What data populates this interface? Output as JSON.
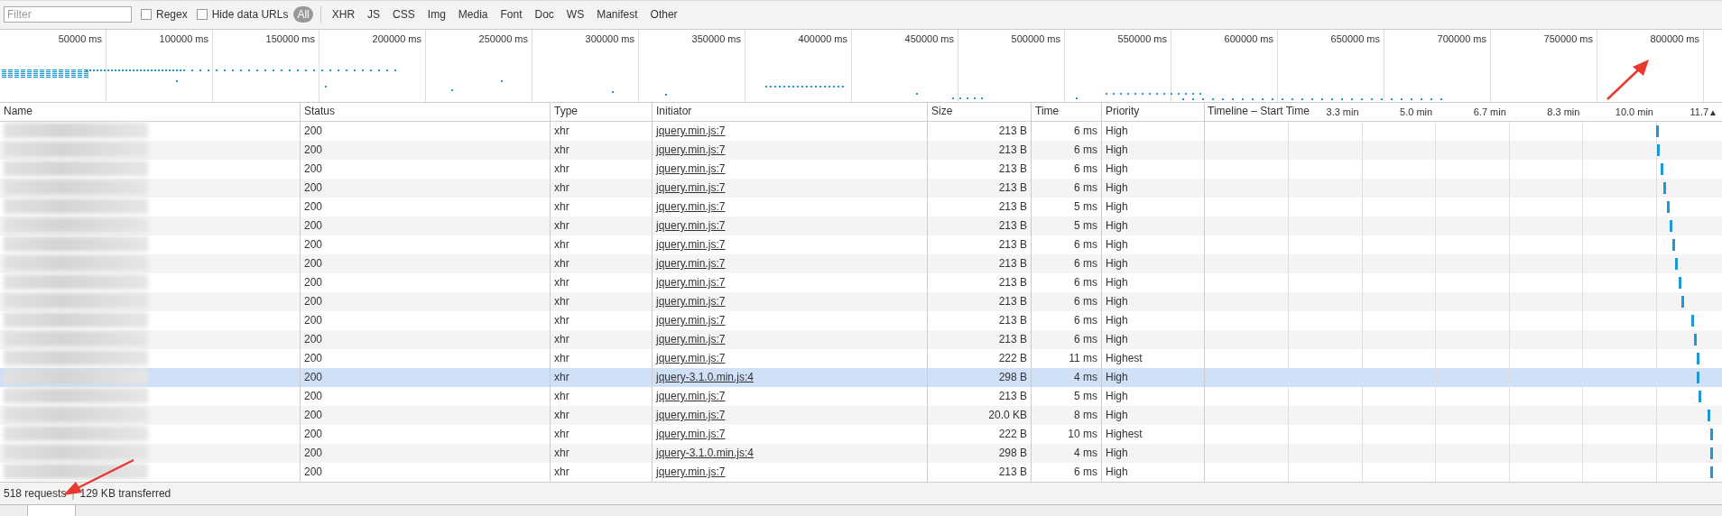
{
  "toolbar": {
    "filter": {
      "placeholder": "Filter"
    },
    "options": [
      {
        "label": "Regex",
        "checked": false
      },
      {
        "label": "Hide data URLs",
        "checked": false
      }
    ],
    "types": [
      {
        "label": "All",
        "selected": true
      },
      {
        "label": "XHR",
        "selected": false
      },
      {
        "label": "JS",
        "selected": false
      },
      {
        "label": "CSS",
        "selected": false
      },
      {
        "label": "Img",
        "selected": false
      },
      {
        "label": "Media",
        "selected": false
      },
      {
        "label": "Font",
        "selected": false
      },
      {
        "label": "Doc",
        "selected": false
      },
      {
        "label": "WS",
        "selected": false
      },
      {
        "label": "Manifest",
        "selected": false
      },
      {
        "label": "Other",
        "selected": false
      }
    ]
  },
  "overview": {
    "ticks": [
      "50000 ms",
      "100000 ms",
      "150000 ms",
      "200000 ms",
      "250000 ms",
      "300000 ms",
      "350000 ms",
      "400000 ms",
      "450000 ms",
      "500000 ms",
      "550000 ms",
      "600000 ms",
      "650000 ms",
      "700000 ms",
      "750000 ms",
      "800000 ms"
    ]
  },
  "table": {
    "columns": [
      "Name",
      "Status",
      "Type",
      "Initiator",
      "Size",
      "Time",
      "Priority"
    ],
    "rows": [
      {
        "status": "200",
        "type": "xhr",
        "initiator": "jquery.min.js:7",
        "size": "213 B",
        "time": "6 ms",
        "priority": "High",
        "selected": false
      },
      {
        "status": "200",
        "type": "xhr",
        "initiator": "jquery.min.js:7",
        "size": "213 B",
        "time": "6 ms",
        "priority": "High",
        "selected": false
      },
      {
        "status": "200",
        "type": "xhr",
        "initiator": "jquery.min.js:7",
        "size": "213 B",
        "time": "6 ms",
        "priority": "High",
        "selected": false
      },
      {
        "status": "200",
        "type": "xhr",
        "initiator": "jquery.min.js:7",
        "size": "213 B",
        "time": "6 ms",
        "priority": "High",
        "selected": false
      },
      {
        "status": "200",
        "type": "xhr",
        "initiator": "jquery.min.js:7",
        "size": "213 B",
        "time": "5 ms",
        "priority": "High",
        "selected": false
      },
      {
        "status": "200",
        "type": "xhr",
        "initiator": "jquery.min.js:7",
        "size": "213 B",
        "time": "5 ms",
        "priority": "High",
        "selected": false
      },
      {
        "status": "200",
        "type": "xhr",
        "initiator": "jquery.min.js:7",
        "size": "213 B",
        "time": "6 ms",
        "priority": "High",
        "selected": false
      },
      {
        "status": "200",
        "type": "xhr",
        "initiator": "jquery.min.js:7",
        "size": "213 B",
        "time": "6 ms",
        "priority": "High",
        "selected": false
      },
      {
        "status": "200",
        "type": "xhr",
        "initiator": "jquery.min.js:7",
        "size": "213 B",
        "time": "6 ms",
        "priority": "High",
        "selected": false
      },
      {
        "status": "200",
        "type": "xhr",
        "initiator": "jquery.min.js:7",
        "size": "213 B",
        "time": "6 ms",
        "priority": "High",
        "selected": false
      },
      {
        "status": "200",
        "type": "xhr",
        "initiator": "jquery.min.js:7",
        "size": "213 B",
        "time": "6 ms",
        "priority": "High",
        "selected": false
      },
      {
        "status": "200",
        "type": "xhr",
        "initiator": "jquery.min.js:7",
        "size": "213 B",
        "time": "6 ms",
        "priority": "High",
        "selected": false
      },
      {
        "status": "200",
        "type": "xhr",
        "initiator": "jquery.min.js:7",
        "size": "222 B",
        "time": "11 ms",
        "priority": "Highest",
        "selected": false
      },
      {
        "status": "200",
        "type": "xhr",
        "initiator": "jquery-3.1.0.min.js:4",
        "size": "298 B",
        "time": "4 ms",
        "priority": "High",
        "selected": true
      },
      {
        "status": "200",
        "type": "xhr",
        "initiator": "jquery.min.js:7",
        "size": "213 B",
        "time": "5 ms",
        "priority": "High",
        "selected": false
      },
      {
        "status": "200",
        "type": "xhr",
        "initiator": "jquery.min.js:7",
        "size": "20.0 KB",
        "time": "8 ms",
        "priority": "High",
        "selected": false
      },
      {
        "status": "200",
        "type": "xhr",
        "initiator": "jquery.min.js:7",
        "size": "222 B",
        "time": "10 ms",
        "priority": "Highest",
        "selected": false
      },
      {
        "status": "200",
        "type": "xhr",
        "initiator": "jquery-3.1.0.min.js:4",
        "size": "298 B",
        "time": "4 ms",
        "priority": "High",
        "selected": false
      },
      {
        "status": "200",
        "type": "xhr",
        "initiator": "jquery.min.js:7",
        "size": "213 B",
        "time": "6 ms",
        "priority": "High",
        "selected": false
      }
    ],
    "timeline": {
      "title": "Timeline – Start Time",
      "ticks": [
        "3.3 min",
        "5.0 min",
        "6.7 min",
        "8.3 min",
        "10.0 min",
        "11.7"
      ],
      "sort": "▲"
    }
  },
  "status_bar": {
    "requests": "518 requests",
    "separator": "|",
    "transferred": "129 KB transferred"
  }
}
